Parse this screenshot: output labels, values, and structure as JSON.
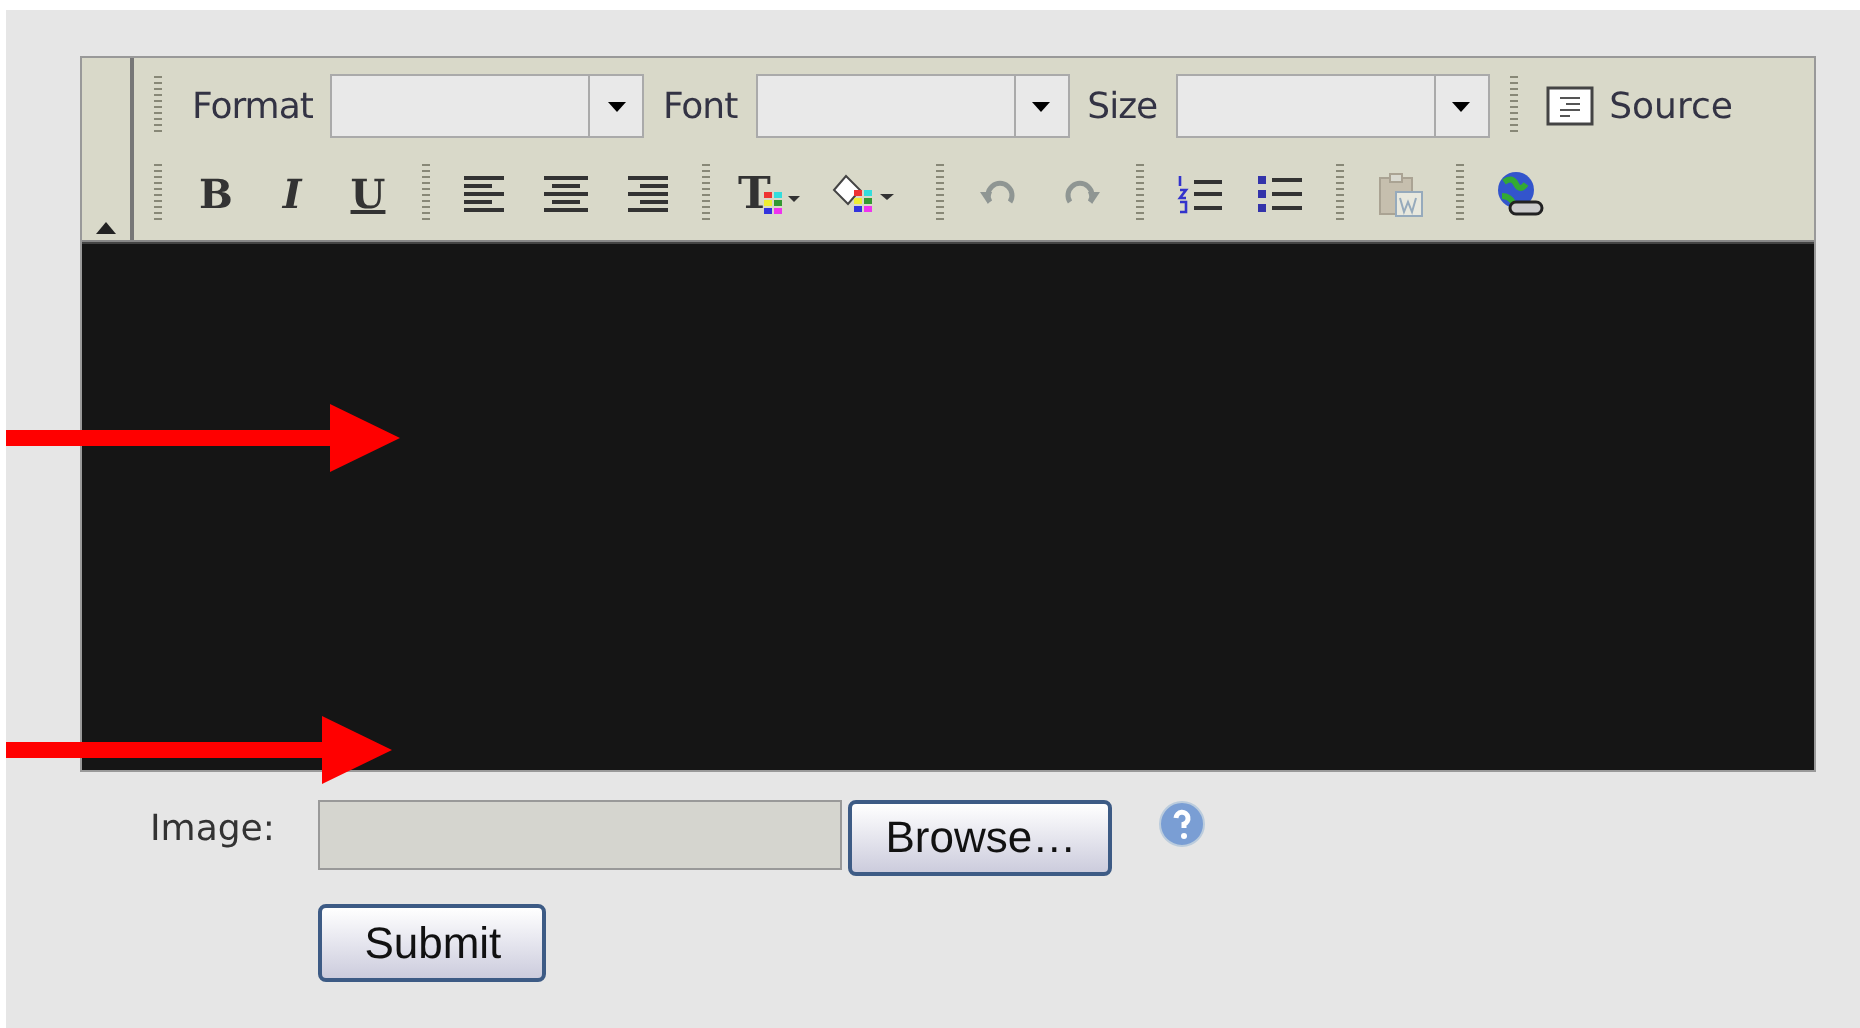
{
  "editor": {
    "toolbar": {
      "combos": [
        {
          "label": "Format"
        },
        {
          "label": "Font"
        },
        {
          "label": "Size"
        }
      ],
      "source_button": {
        "label": "Source"
      },
      "groups": [
        [
          {
            "kind": "text",
            "label": "B",
            "disabled": false
          },
          {
            "kind": "text",
            "label": "I",
            "disabled": false
          },
          {
            "kind": "text",
            "label": "U",
            "disabled": false
          }
        ],
        [
          {
            "kind": "align-left",
            "disabled": false
          },
          {
            "kind": "align-center",
            "disabled": false
          },
          {
            "kind": "align-right",
            "disabled": false
          }
        ],
        [
          {
            "kind": "text-color",
            "label": "T",
            "disabled": false
          },
          {
            "kind": "bg-color",
            "disabled": false
          }
        ],
        [
          {
            "kind": "undo",
            "disabled": true
          },
          {
            "kind": "redo",
            "disabled": true
          }
        ],
        [
          {
            "kind": "ordered-list",
            "disabled": false
          },
          {
            "kind": "bullet-list",
            "disabled": false
          }
        ],
        [
          {
            "kind": "paste",
            "disabled": true
          }
        ],
        [
          {
            "kind": "link",
            "disabled": false
          }
        ]
      ]
    }
  },
  "form": {
    "image_label": "Image:",
    "browse_button": "Browse…",
    "submit_button": "Submit"
  }
}
